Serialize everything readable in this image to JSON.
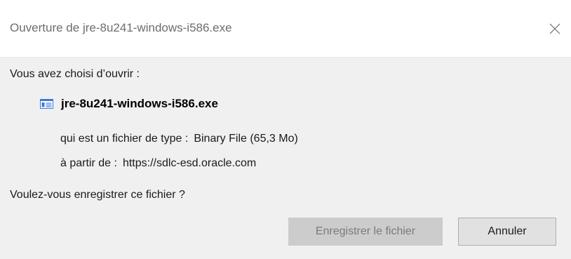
{
  "window": {
    "title": "Ouverture de jre-8u241-windows-i586.exe",
    "close_icon": "close-icon"
  },
  "dialog": {
    "prompt_open": "Vous avez choisi d’ouvrir :",
    "file": {
      "icon": "exe-file-icon",
      "name": "jre-8u241-windows-i586.exe"
    },
    "type_label": "qui est un fichier de type :",
    "type_value": "Binary File (65,3 Mo)",
    "source_label": "à partir de :",
    "source_value": "https://sdlc-esd.oracle.com",
    "prompt_save": "Voulez-vous enregistrer ce fichier ?"
  },
  "buttons": {
    "save_label": "Enregistrer le fichier",
    "save_disabled": true,
    "cancel_label": "Annuler"
  },
  "colors": {
    "title_text": "#6d6d6d",
    "content_bg": "#f0f0f0",
    "disabled_button_bg": "#cccccc",
    "disabled_button_text": "#7a7a7a",
    "button_bg": "#e1e1e1",
    "button_border": "#adadad"
  }
}
